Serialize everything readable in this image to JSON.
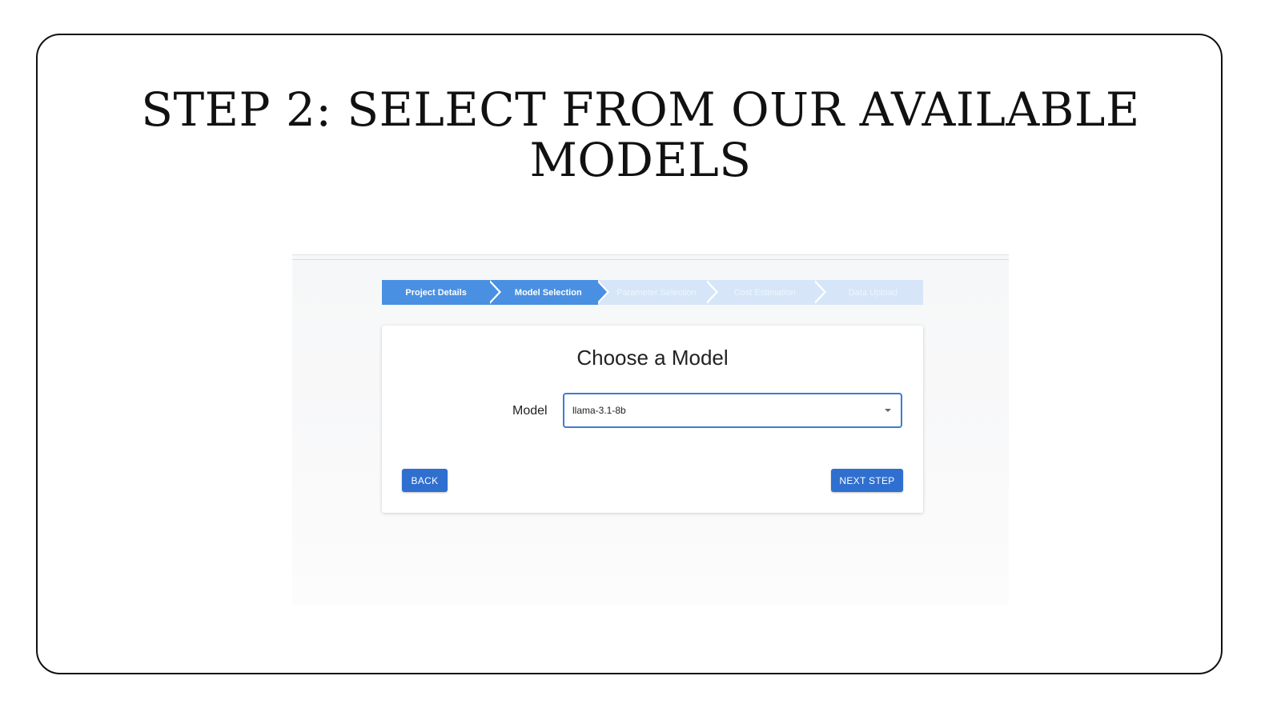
{
  "slide": {
    "title_line1": "STEP 2: SELECT FROM OUR AVAILABLE",
    "title_line2": "MODELS"
  },
  "stepper": {
    "steps": [
      {
        "label": "Project Details",
        "state": "complete"
      },
      {
        "label": "Model Selection",
        "state": "current"
      },
      {
        "label": "Parameter Selection",
        "state": "upcoming"
      },
      {
        "label": "Cost Estimation",
        "state": "upcoming"
      },
      {
        "label": "Data Upload",
        "state": "upcoming"
      }
    ]
  },
  "card": {
    "title": "Choose a Model",
    "model_label": "Model",
    "model_value": "llama-3.1-8b",
    "back_label": "BACK",
    "next_label": "NEXT STEP"
  },
  "colors": {
    "active_step": "#4a90e2",
    "inactive_step": "#d6e6f8",
    "button": "#2f6fcf",
    "select_border": "#3f7bd0"
  }
}
